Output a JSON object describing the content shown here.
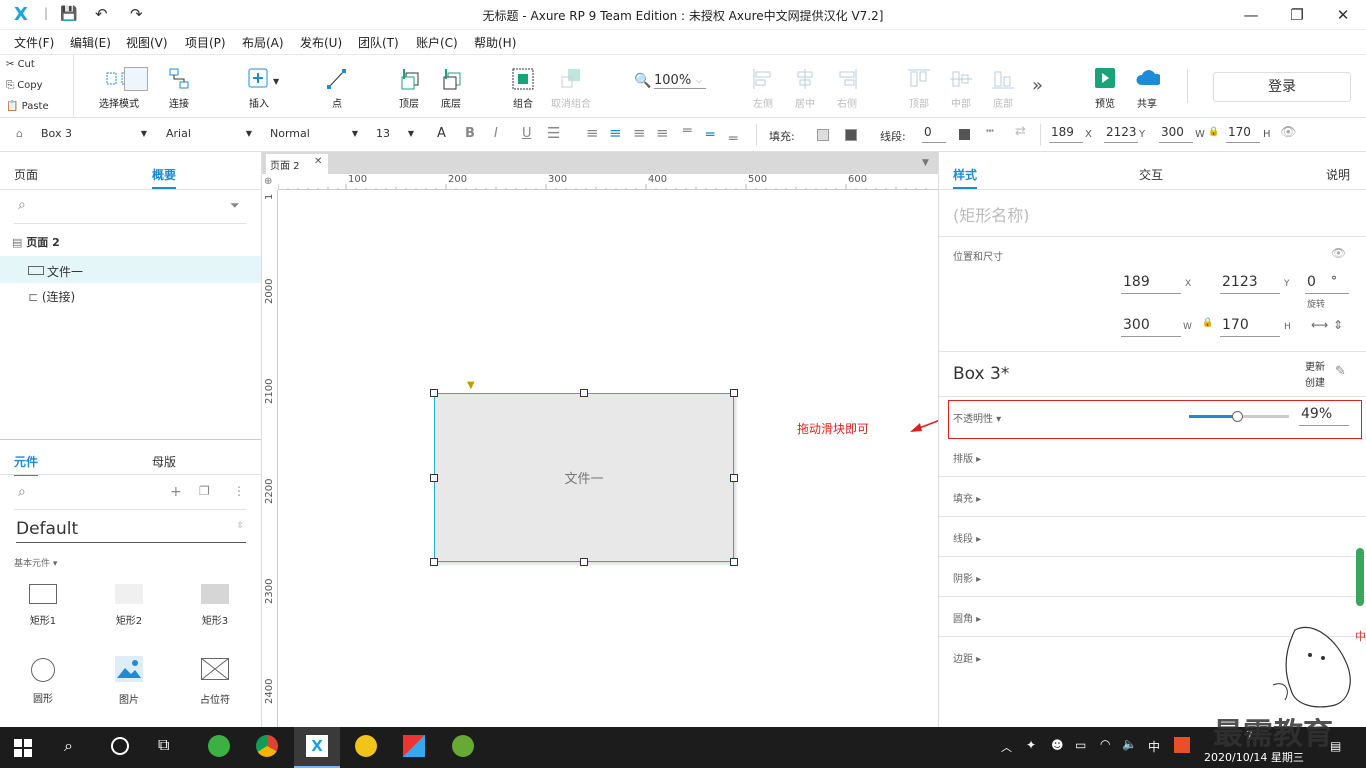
{
  "window": {
    "title": "无标题 - Axure RP 9 Team Edition : 未授权    Axure中文网提供汉化 V7.2]",
    "minimize": "—",
    "maximize": "❐",
    "close": "✕"
  },
  "menu": [
    "文件(F)",
    "编辑(E)",
    "视图(V)",
    "项目(P)",
    "布局(A)",
    "发布(U)",
    "团队(T)",
    "账户(C)",
    "帮助(H)"
  ],
  "clipboard": {
    "cut": "Cut",
    "copy": "Copy",
    "paste": "Paste"
  },
  "toolbar": {
    "select_mode": "选择模式",
    "connect": "连接",
    "insert": "插入",
    "point": "点",
    "top_layer": "顶层",
    "bottom_layer": "底层",
    "group": "组合",
    "ungroup": "取消组合",
    "zoom": "100%",
    "align_left": "左侧",
    "align_center": "居中",
    "align_right": "右侧",
    "align_top": "顶部",
    "align_middle": "中部",
    "align_bottom": "底部",
    "more": "»",
    "preview": "预览",
    "share": "共享",
    "login": "登录"
  },
  "format": {
    "widget_name": "Box 3",
    "font": "Arial",
    "style": "Normal",
    "size": "13",
    "fill_label": "填充:",
    "line_label": "线段:",
    "line_value": "0",
    "x": "189",
    "x_label": "X",
    "y": "2123",
    "y_label": "Y",
    "w": "300",
    "w_label": "W",
    "h": "170",
    "h_label": "H"
  },
  "left": {
    "tab_pages": "页面",
    "tab_outline": "概要",
    "outline_root": "页面 2",
    "outline_items": [
      "文件一",
      "(连接)"
    ],
    "tab_widgets": "元件",
    "tab_masters": "母版",
    "library": "Default",
    "group_label": "基本元件 ▾",
    "widgets": [
      "矩形1",
      "矩形2",
      "矩形3",
      "圆形",
      "图片",
      "占位符"
    ]
  },
  "canvas": {
    "page_tab": "页面 2",
    "hruler": [
      "100",
      "200",
      "300",
      "400",
      "500",
      "600"
    ],
    "vruler": [
      "1",
      "2000",
      "2100",
      "2200",
      "2300",
      "2400"
    ],
    "shape_text": "文件一",
    "annotation": "拖动滑块即可"
  },
  "right": {
    "tab_style": "样式",
    "tab_interaction": "交互",
    "tab_notes": "说明",
    "shape_name_placeholder": "(矩形名称)",
    "pos_size_label": "位置和尺寸",
    "x": "189",
    "y": "2123",
    "rotation": "0",
    "w": "300",
    "h": "170",
    "x_label": "X",
    "y_label": "Y",
    "deg_label": "°",
    "rot_label": "旋转",
    "w_label": "W",
    "h_label": "H",
    "style_name": "Box 3*",
    "update_label": "更新",
    "create_label": "创建",
    "opacity_label": "不透明性 ▾",
    "opacity_value": "49%",
    "opacity_fraction": 0.49,
    "sections": [
      "排版 ▸",
      "填充 ▸",
      "线段 ▸",
      "阴影 ▸",
      "圆角 ▸",
      "边距 ▸"
    ]
  },
  "taskbar": {
    "time": "7",
    "date": "2020/10/14 星期三",
    "ime": "中",
    "watermark": "最需教育"
  },
  "colors": {
    "accent": "#1e8bd6",
    "annotation": "#e02020",
    "selection": "#2ab0c5",
    "shape_fill": "#e8e8e8"
  }
}
